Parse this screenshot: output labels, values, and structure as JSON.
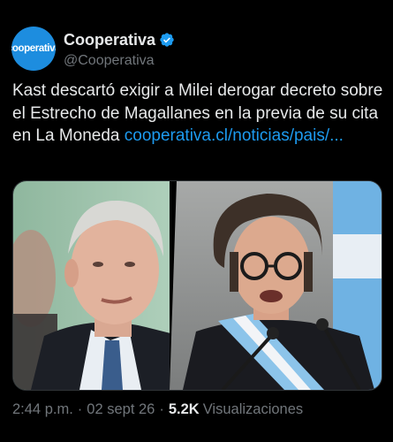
{
  "author": {
    "display_name": "Cooperativa",
    "handle": "@Cooperativa",
    "avatar_text": "cooperativa",
    "verified": true,
    "brand_color": "#1d8ddf"
  },
  "tweet": {
    "text": "Kast descartó exigir a Milei derogar decreto sobre el Estrecho de Magallanes en la previa de su cita en La Moneda ",
    "link_text": "cooperativa.cl/noticias/pais/...",
    "link_color": "#1d9bf0"
  },
  "media": {
    "photos": [
      {
        "icon": "photo-man-suit-blue-tie"
      },
      {
        "icon": "photo-man-glasses-presidential-sash"
      }
    ]
  },
  "meta": {
    "time": "2:44 p.m.",
    "date": "02 sept 26",
    "views_count": "5.2K",
    "views_label": "Visualizaciones",
    "separator": "·"
  },
  "colors": {
    "background": "#000000",
    "text_primary": "#e7e9ea",
    "text_secondary": "#71767b",
    "verified_badge": "#1d9bf0"
  }
}
